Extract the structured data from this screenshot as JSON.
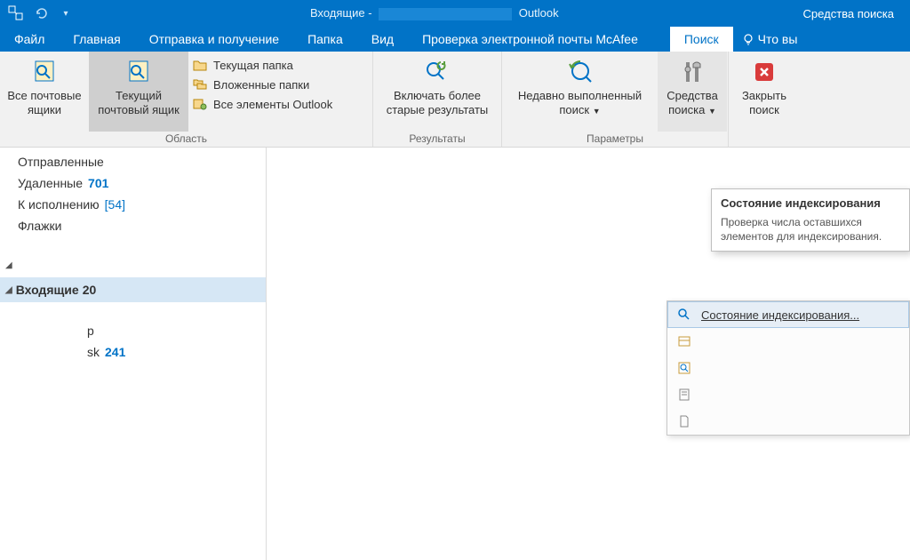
{
  "titlebar": {
    "prefix": "Входящие -",
    "suffix": "Outlook",
    "tool_context": "Средства поиска"
  },
  "menu": {
    "file": "Файл",
    "home": "Главная",
    "sendreceive": "Отправка и получение",
    "folder": "Папка",
    "view": "Вид",
    "mcafee": "Проверка электронной почты McAfee",
    "search": "Поиск",
    "tellme": "Что вы"
  },
  "ribbon": {
    "scope": {
      "all_mailboxes": "Все почтовые ящики",
      "current_mailbox": "Текущий почтовый ящик",
      "current_folder": "Текущая папка",
      "subfolders": "Вложенные папки",
      "all_outlook": "Все элементы Outlook",
      "group": "Область"
    },
    "refine": {
      "include_older": "Включать более старые результаты",
      "group": "Результаты"
    },
    "options": {
      "recent": "Недавно выполненный поиск",
      "tools": "Средства поиска",
      "group": "Параметры"
    },
    "close": {
      "close": "Закрыть поиск"
    }
  },
  "dropdown": {
    "indexing_status": "Состояние индексирования..."
  },
  "tooltip": {
    "title": "Состояние индексирования",
    "body": "Проверка числа оставшихся элементов для индексирования."
  },
  "folders": {
    "sent": "Отправленные",
    "deleted": "Удаленные",
    "deleted_count": "701",
    "followup": "К исполнению",
    "followup_count": "[54]",
    "flags": "Флажки",
    "inbox": "Входящие",
    "inbox_count": "20",
    "sub1_suffix": "р",
    "sub2_suffix": "sk",
    "sub2_count": "241"
  }
}
